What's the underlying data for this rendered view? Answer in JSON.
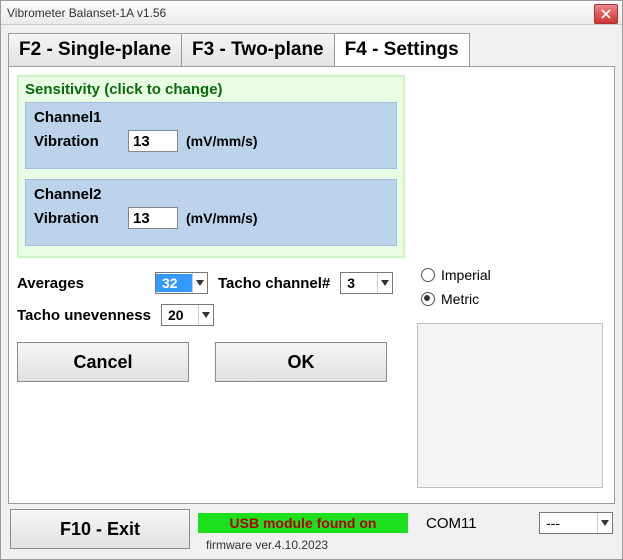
{
  "window": {
    "title": "Vibrometer Balanset-1A  v1.56"
  },
  "tabs": {
    "f2": "F2 - Single-plane",
    "f3": "F3 - Two-plane",
    "f4": "F4 - Settings"
  },
  "sensitivity": {
    "legend": "Sensitivity (click to change)",
    "channel1": {
      "title": "Channel1",
      "label": "Vibration",
      "value": "13",
      "unit": "(mV/mm/s)"
    },
    "channel2": {
      "title": "Channel2",
      "label": "Vibration",
      "value": "13",
      "unit": "(mV/mm/s)"
    }
  },
  "settings": {
    "averages_label": "Averages",
    "averages_value": "32",
    "tacho_channel_label": "Tacho channel#",
    "tacho_channel_value": "3",
    "tacho_unevenness_label": "Tacho unevenness",
    "tacho_unevenness_value": "20"
  },
  "buttons": {
    "cancel": "Cancel",
    "ok": "OK",
    "exit": "F10 - Exit"
  },
  "units": {
    "imperial": "Imperial",
    "metric": "Metric",
    "selected": "metric"
  },
  "status": {
    "usb": "USB module found on",
    "com": "COM11",
    "port_value": "---",
    "firmware": "firmware ver.4.10.2023"
  }
}
